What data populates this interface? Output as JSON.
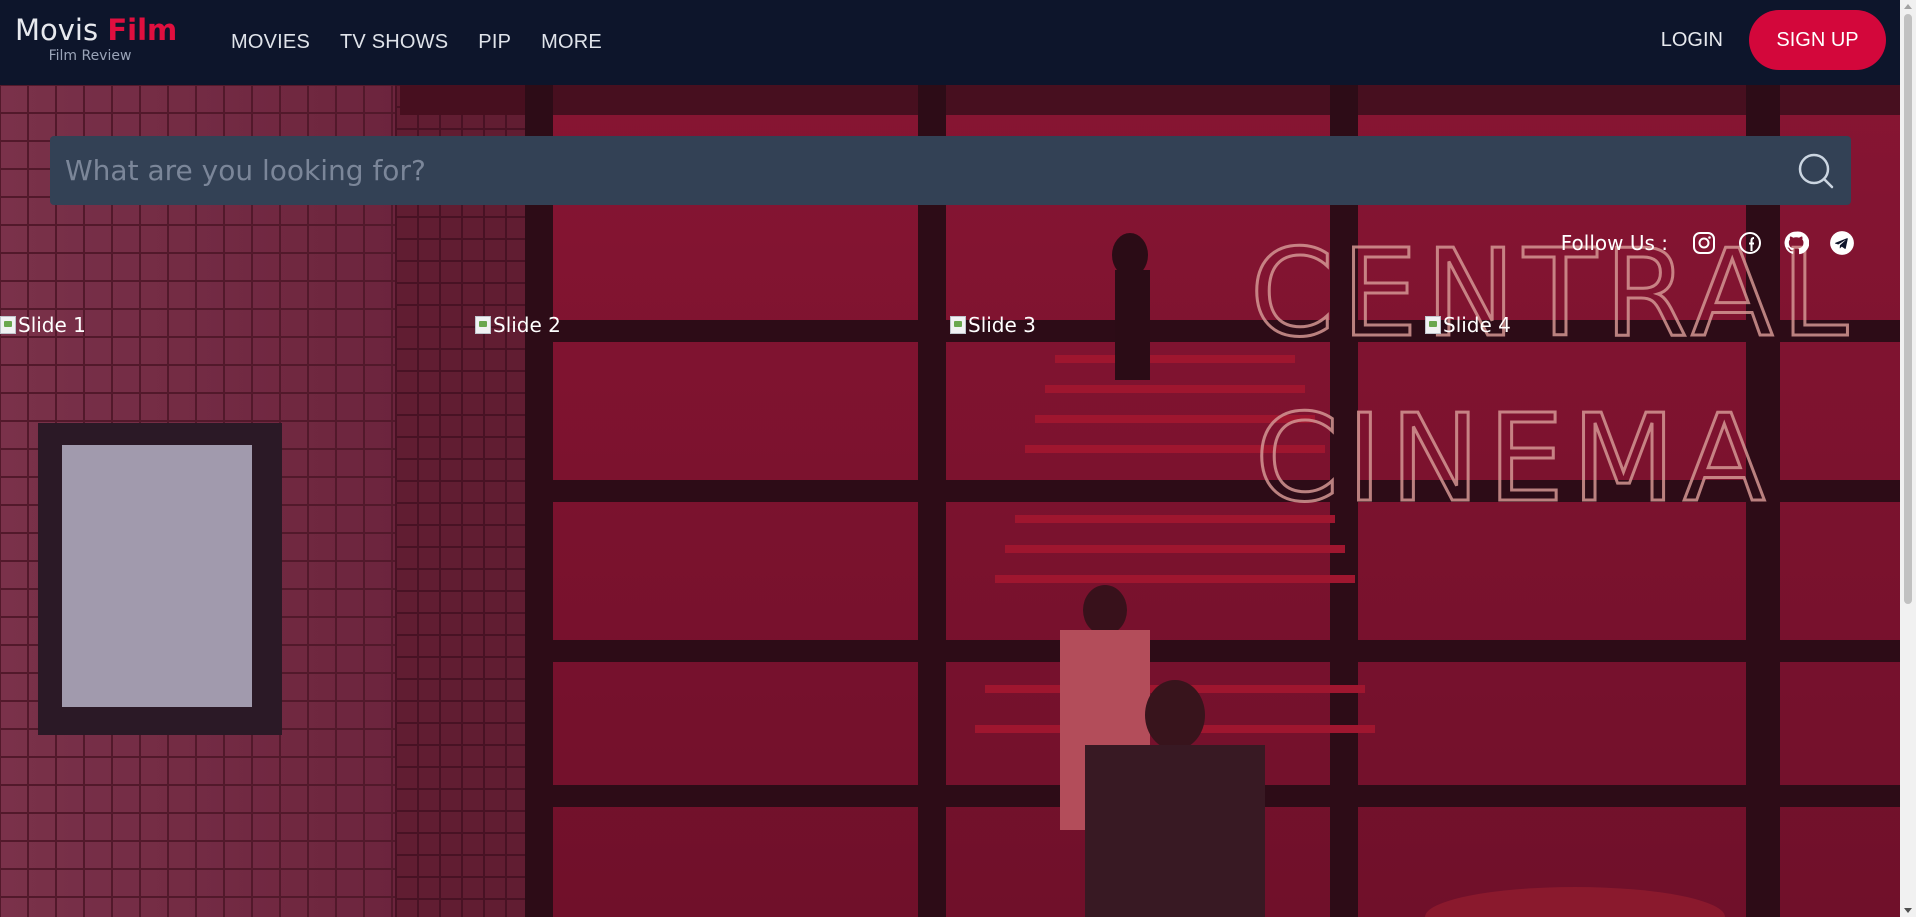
{
  "header": {
    "logo_main": "Movis",
    "logo_accent": "Film",
    "logo_sub": "Film Review",
    "nav": [
      "MOVIES",
      "TV SHOWS",
      "PIP",
      "MORE"
    ],
    "login_label": "LOGIN",
    "signup_label": "SIGN UP"
  },
  "search": {
    "placeholder": "What are you looking for?",
    "value": ""
  },
  "follow": {
    "label": "Follow Us :",
    "icons": [
      "instagram-icon",
      "facebook-icon",
      "github-icon",
      "telegram-icon"
    ]
  },
  "slides": [
    {
      "alt": "Slide 1"
    },
    {
      "alt": "Slide 2"
    },
    {
      "alt": "Slide 3"
    },
    {
      "alt": "Slide 4"
    }
  ],
  "hero_signage": {
    "line1": "CENTRAL",
    "line2": "CINEMA"
  },
  "colors": {
    "header_bg": "#0d152b",
    "accent": "#d3073b",
    "search_bg": "#334155",
    "neon": "#e8a7b0"
  }
}
